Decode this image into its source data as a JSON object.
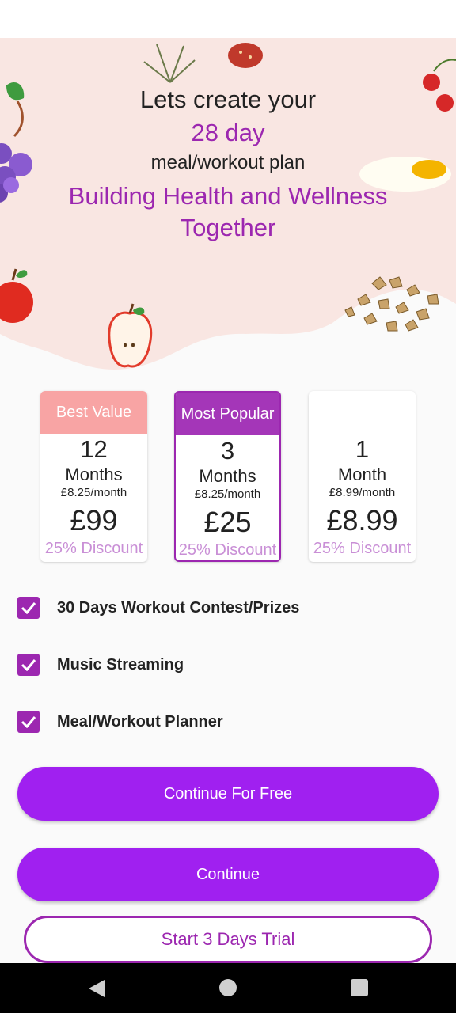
{
  "header": {
    "line1": "Lets create your",
    "line2": "28 day",
    "line3": "meal/workout plan",
    "tagline": "Building Health and Wellness Together"
  },
  "plans": [
    {
      "badge": "Best Value",
      "count": "12",
      "unit": "Months",
      "monthly": "£8.25/month",
      "price": "£99",
      "discount": "25% Discount"
    },
    {
      "badge": "Most Popular",
      "count": "3",
      "unit": "Months",
      "monthly": "£8.25/month",
      "price": "£25",
      "discount": "25% Discount"
    },
    {
      "badge": "",
      "count": "1",
      "unit": "Month",
      "monthly": "£8.99/month",
      "price": "£8.99",
      "discount": "25% Discount"
    }
  ],
  "features": [
    {
      "label": "30 Days Workout Contest/Prizes",
      "checked": true
    },
    {
      "label": "Music Streaming",
      "checked": true
    },
    {
      "label": "Meal/Workout Planner",
      "checked": true
    }
  ],
  "buttons": {
    "continue_free": "Continue For Free",
    "continue": "Continue",
    "trial": "Start 3 Days Trial"
  },
  "icons": {
    "check": "check-icon",
    "back": "back-icon",
    "home": "home-icon",
    "recents": "recents-icon"
  },
  "colors": {
    "accent": "#9c27b0",
    "button": "#a020f0",
    "hero_bg": "#f9e6e2",
    "best_value_badge": "#f8a4a4"
  }
}
